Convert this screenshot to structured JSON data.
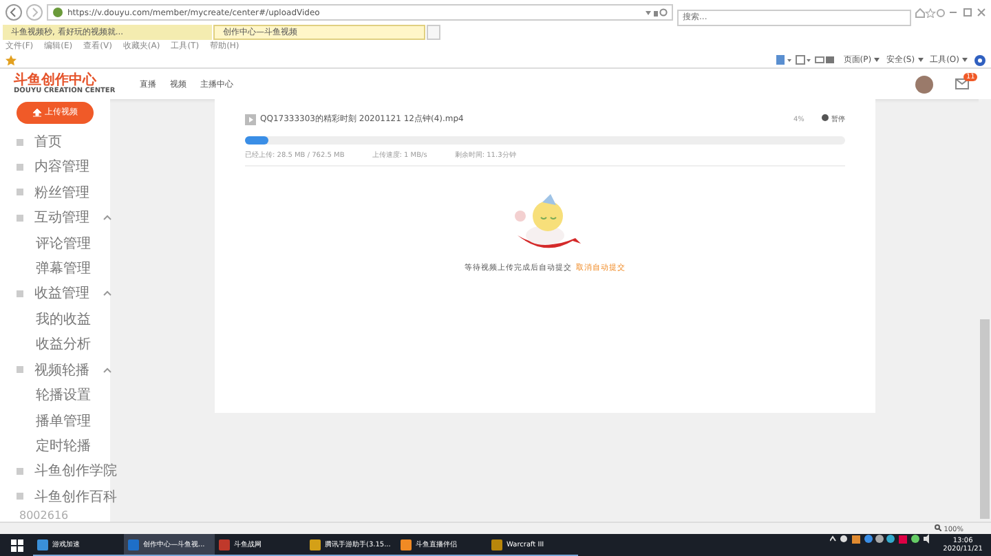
{
  "browser": {
    "url": "https://v.douyu.com/member/mycreate/center#/uploadVideo",
    "search": {
      "placeholder": "搜索..."
    },
    "tabs": [
      {
        "label": "斗鱼视频秒, 看好玩的视频就...",
        "selected": false
      },
      {
        "label": "创作中心—斗鱼视频",
        "selected": true
      }
    ],
    "menu": [
      "文件(F)",
      "编辑(E)",
      "查看(V)",
      "收藏夹(A)",
      "工具(T)",
      "帮助(H)"
    ],
    "commands": [
      "页面(P)",
      "安全(S)",
      "工具(O)"
    ]
  },
  "site": {
    "logo": "斗鱼创作中心",
    "logo_subtitle": "DOUYU CREATION CENTER",
    "nav": [
      "直播",
      "视频",
      "主播中心"
    ],
    "mail_badge": "11"
  },
  "sidebar": {
    "upload_button": "上传视频",
    "items": [
      {
        "label": "首页"
      },
      {
        "label": "内容管理"
      },
      {
        "label": "粉丝管理"
      },
      {
        "label": "互动管理",
        "expanded": true,
        "children": [
          "评论管理",
          "弹幕管理"
        ]
      },
      {
        "label": "收益管理",
        "expanded": true,
        "children": [
          "我的收益",
          "收益分析"
        ]
      },
      {
        "label": "视频轮播",
        "expanded": true,
        "children": [
          "轮播设置",
          "播单管理",
          "定时轮播"
        ]
      },
      {
        "label": "斗鱼创作学院"
      },
      {
        "label": "斗鱼创作百科"
      }
    ],
    "footer": "8002616"
  },
  "upload": {
    "filename": "QQ17333303的精彩时刻 20201121 12点钟(4).mp4",
    "percent": "4%",
    "pause": "暂停",
    "level": 0.04,
    "stats": [
      "已经上传: 28.5 MB / 762.5 MB",
      "上传速度: 1 MB/s",
      "剩余时间: 11.3分钟"
    ],
    "message": "等待视频上传完成后自动提交",
    "cancel_link": "取消自动提交"
  },
  "status_bar": {
    "zoom": "100%"
  },
  "taskbar": {
    "items": [
      {
        "label": "游戏加速",
        "selected": false
      },
      {
        "label": "创作中心—斗鱼视...",
        "selected": true
      },
      {
        "label": "斗鱼战网",
        "selected": false
      },
      {
        "label": "腾讯手游助手(3.15...",
        "selected": false
      },
      {
        "label": "斗鱼直播伴侣",
        "selected": false
      },
      {
        "label": "Warcraft III",
        "selected": false
      }
    ],
    "time": "13:06",
    "date": "2020/11/21"
  }
}
